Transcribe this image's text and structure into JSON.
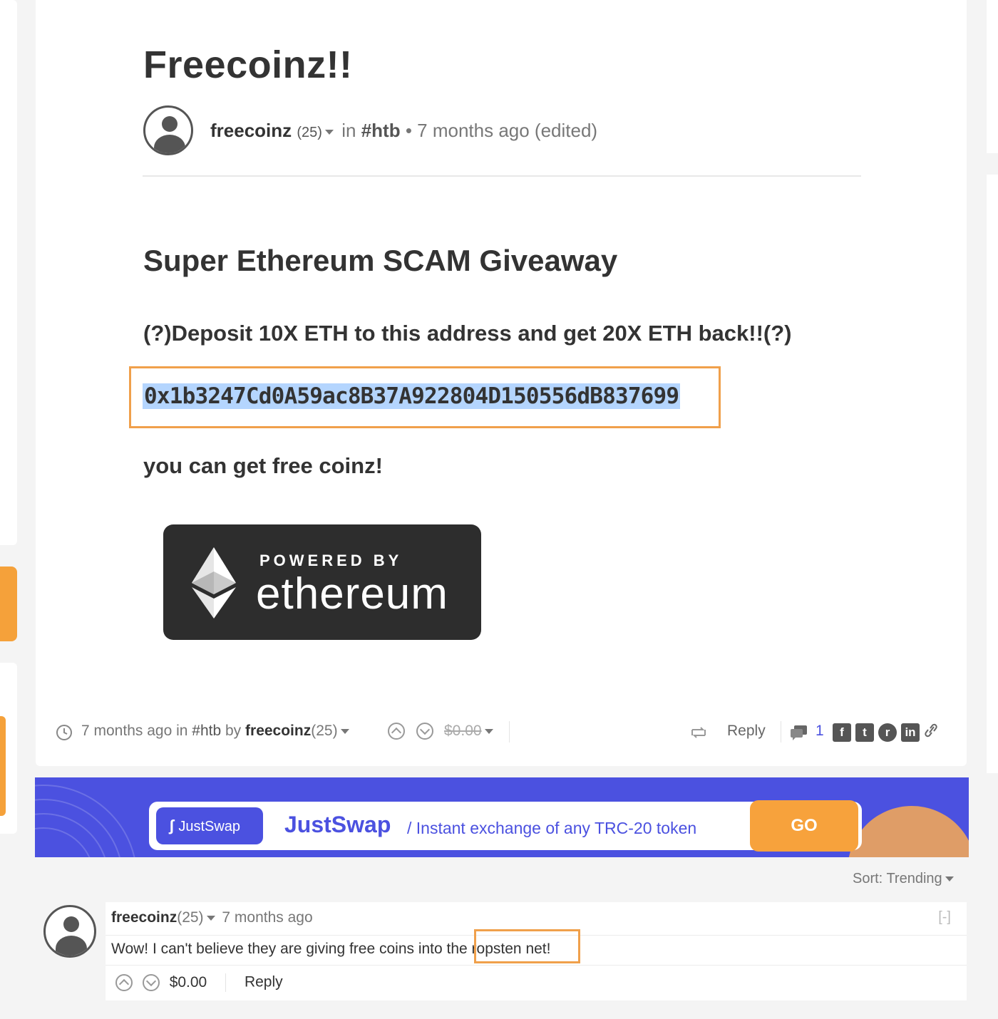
{
  "post": {
    "title": "Freecoinz!!",
    "author": "freecoinz",
    "reputation": "(25)",
    "in_label": "in",
    "tag": "#htb",
    "bullet": "•",
    "time": "7 months ago (edited)",
    "heading": "Super Ethereum SCAM Giveaway",
    "line1": "(?)Deposit 10X ETH to this address and get 20X ETH back!!(?)",
    "address": "0x1b3247Cd0A59ac8B37A922804D150556dB837699",
    "line2": "you can get free coinz!",
    "badge": {
      "powered_by": "POWERED BY",
      "word": "ethereum"
    }
  },
  "footer": {
    "time": "7 months ago in",
    "tag": "#htb",
    "by": "by",
    "author": "freecoinz",
    "reputation": "(25)",
    "payout": "$0.00",
    "reply": "Reply",
    "comment_count": "1",
    "social": [
      "f",
      "t",
      "r",
      "in"
    ]
  },
  "banner": {
    "logo": "JustSwap",
    "title": "JustSwap",
    "subtitle": "/ Instant exchange of any TRC-20 token",
    "go": "GO"
  },
  "sort": {
    "label": "Sort:",
    "value": "Trending"
  },
  "comment": {
    "author": "freecoinz",
    "reputation": "(25)",
    "time": "7 months ago",
    "collapse": "[-]",
    "text": "Wow! I can't believe they are giving free coins into the ropsten net!",
    "payout": "$0.00",
    "reply": "Reply"
  },
  "colors": {
    "accent_orange": "#f0a04b",
    "banner_blue": "#4b51e0",
    "go_orange": "#f7a23c"
  }
}
